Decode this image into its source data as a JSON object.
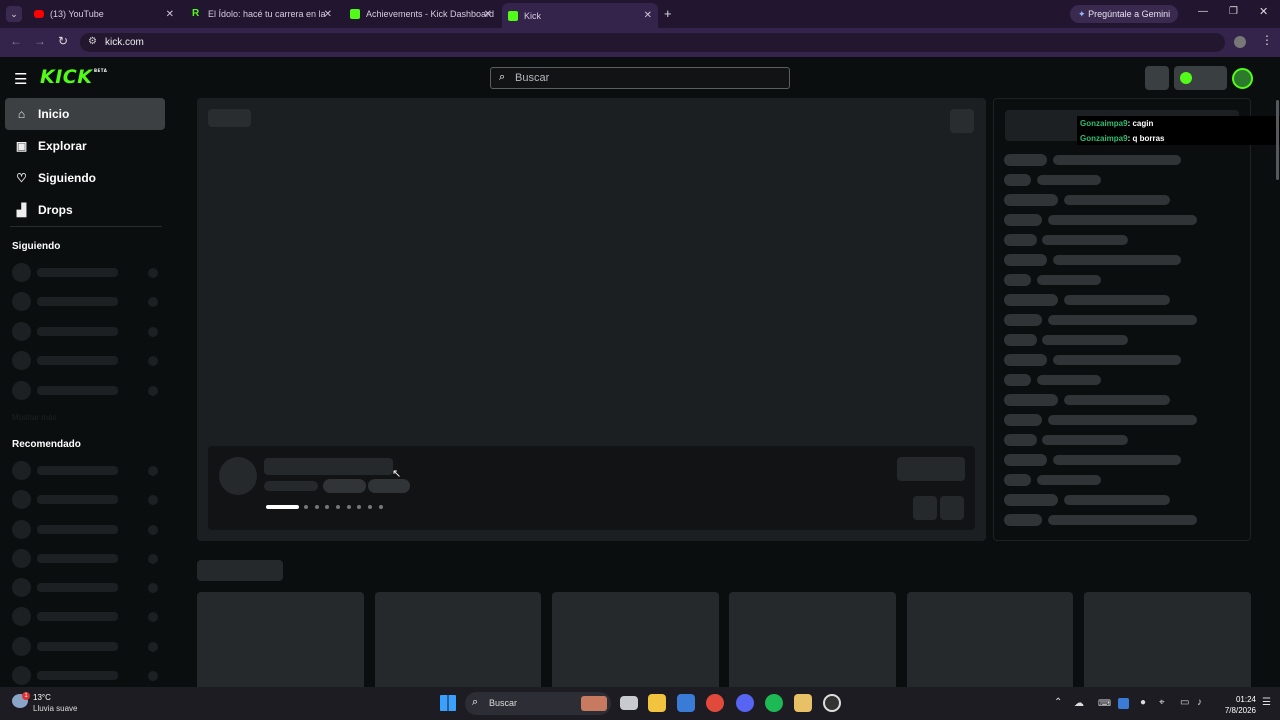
{
  "browser": {
    "tabs": [
      {
        "title": "(13) YouTube",
        "active": false
      },
      {
        "title": "El Ídolo: hacé tu carrera en la Li",
        "active": false
      },
      {
        "title": "Achievements - Kick Dashboard",
        "active": false
      },
      {
        "title": "Kick",
        "active": true
      }
    ],
    "gemini_label": "Pregúntale a Gemini",
    "url": "kick.com"
  },
  "kick": {
    "logo": "KICK",
    "logo_badge": "BETA",
    "search_placeholder": "Buscar",
    "nav": [
      {
        "label": "Inicio",
        "icon": "home-icon",
        "active": true
      },
      {
        "label": "Explorar",
        "icon": "compass-icon",
        "active": false
      },
      {
        "label": "Siguiendo",
        "icon": "heart-icon",
        "active": false
      },
      {
        "label": "Drops",
        "icon": "drops-icon",
        "active": false
      }
    ],
    "following_header": "Siguiendo",
    "show_more": "Mostrar más",
    "recommended_header": "Recomendado",
    "chat_overlay": [
      {
        "user": "Gonzaimpa9",
        "message": ": cagin"
      },
      {
        "user": "Gonzaimpa9",
        "message": ": q borras"
      }
    ]
  },
  "taskbar": {
    "weather_temp": "13°C",
    "weather_desc": "Lluvia suave",
    "weather_badge": "1",
    "search_label": "Buscar",
    "time": "01:24",
    "date": "7/8/2026"
  },
  "colors": {
    "brand": "#53fc18",
    "chat_user": "#2fbf71"
  }
}
